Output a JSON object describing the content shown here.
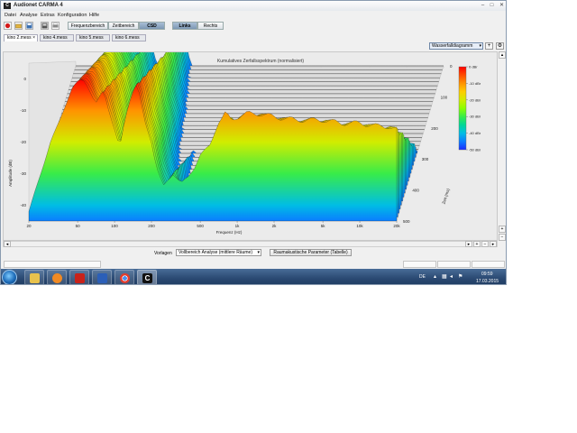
{
  "window": {
    "title": "Audionet CARMA 4"
  },
  "menu": [
    "Datei",
    "Analyse",
    "Extras",
    "Konfiguration",
    "Hilfe"
  ],
  "toolbar": {
    "views": [
      "Frequenzbereich",
      "Zeitbereich",
      "CSD"
    ],
    "active_view": "CSD",
    "channels": [
      "Links",
      "Rechts"
    ],
    "active_channel": "Links"
  },
  "tabs": [
    {
      "label": "kino 2.mess",
      "closable": true
    },
    {
      "label": "kino 4.mess",
      "closable": false
    },
    {
      "label": "kino 5.mess",
      "closable": false
    },
    {
      "label": "kino 6.mess",
      "closable": false
    }
  ],
  "view_select": {
    "value": "Wasserfalldiagramm"
  },
  "chart_data": {
    "type": "waterfall",
    "title": "Kumulatives Zerfallsspektrum (normalisiert)",
    "xlabel": "Frequenz (Hz)",
    "ylabel": "Amplitude (dB)",
    "zlabel": "Zeit (ms)",
    "x_ticks": [
      "20",
      "50",
      "100",
      "200",
      "500",
      "1k",
      "2k",
      "5k",
      "10k",
      "20k"
    ],
    "y_ticks": [
      "0",
      "-10",
      "-20",
      "-30",
      "-40"
    ],
    "z_ticks": [
      "0",
      "100",
      "200",
      "300",
      "400",
      "500"
    ],
    "colorbar_ticks": [
      "0 dBr",
      "-10 dBr",
      "-20 dBr",
      "-30 dBr",
      "-40 dBr",
      "-50 dBr"
    ],
    "slices": 40,
    "profile_db": [
      [
        20,
        -42
      ],
      [
        25,
        -30
      ],
      [
        30,
        -20
      ],
      [
        35,
        -14
      ],
      [
        40,
        -8
      ],
      [
        45,
        -3
      ],
      [
        50,
        -1
      ],
      [
        55,
        0
      ],
      [
        60,
        -2
      ],
      [
        65,
        -5
      ],
      [
        70,
        -8
      ],
      [
        75,
        -6
      ],
      [
        80,
        -4
      ],
      [
        85,
        -6
      ],
      [
        90,
        -10
      ],
      [
        100,
        -16
      ],
      [
        110,
        -22
      ],
      [
        120,
        -14
      ],
      [
        130,
        -8
      ],
      [
        140,
        -4
      ],
      [
        150,
        -2
      ],
      [
        160,
        -5
      ],
      [
        175,
        -13
      ],
      [
        200,
        -20
      ],
      [
        220,
        -28
      ],
      [
        250,
        -34
      ],
      [
        300,
        -30
      ],
      [
        350,
        -33
      ],
      [
        400,
        -31
      ],
      [
        450,
        -28
      ],
      [
        500,
        -24
      ],
      [
        600,
        -21
      ],
      [
        700,
        -14
      ],
      [
        800,
        -11
      ],
      [
        900,
        -13
      ],
      [
        1000,
        -12
      ],
      [
        1200,
        -11
      ],
      [
        1500,
        -11
      ],
      [
        2000,
        -12
      ],
      [
        3000,
        -13
      ],
      [
        4000,
        -13
      ],
      [
        5000,
        -13
      ],
      [
        7000,
        -14
      ],
      [
        10000,
        -14
      ],
      [
        14000,
        -15
      ],
      [
        17000,
        -15
      ],
      [
        20000,
        -16
      ]
    ],
    "colorbar": {
      "min_db": -50,
      "max_db": 0
    },
    "colors": [
      "#1a2bff",
      "#00b4ff",
      "#00e07a",
      "#8cff00",
      "#ffe100",
      "#ff7f00",
      "#ff0000"
    ]
  },
  "bottom": {
    "preset_label": "Vorlagen",
    "preset_value": "Vollbereich Analyse (mittlere Räume)",
    "param_button": "Raumakustische Parameter (Tabelle)"
  },
  "taskbar": {
    "lang": "DE",
    "time": "09:59",
    "date": "17.03.2015"
  }
}
